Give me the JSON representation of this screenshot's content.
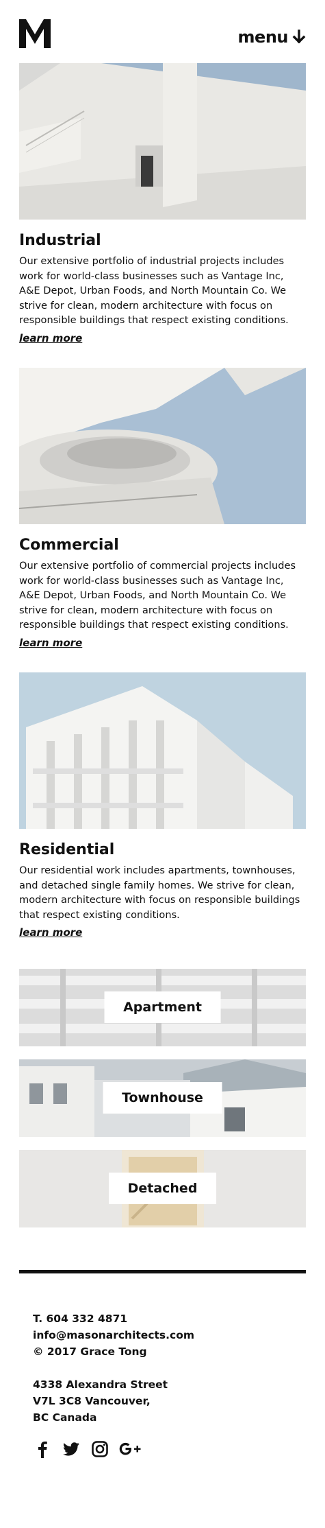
{
  "header": {
    "logo_icon": "mason-logo-icon",
    "menu_label": "menu",
    "menu_icon": "arrow-down-icon"
  },
  "projects": [
    {
      "title": "Industrial",
      "description": "Our extensive portfolio of industrial projects includes work for world-class businesses such as Vantage Inc, A&E Depot, Urban Foods, and North Mountain Co. We strive for clean, modern architecture with focus on responsible buildings that respect existing conditions.",
      "link": "learn more"
    },
    {
      "title": "Commercial",
      "description": "Our extensive portfolio of commercial projects includes work for world-class businesses such as Vantage Inc, A&E Depot, Urban Foods, and North Mountain Co. We strive for clean, modern architecture with focus on responsible buildings that respect existing conditions.",
      "link": "learn more"
    },
    {
      "title": "Residential",
      "description": "Our residential work includes apartments, townhouses, and detached single family homes. We strive for clean, modern architecture with focus on responsible buildings that respect existing conditions.",
      "link": "learn more"
    }
  ],
  "categories": [
    {
      "label": "Apartment"
    },
    {
      "label": "Townhouse"
    },
    {
      "label": "Detached"
    }
  ],
  "footer": {
    "phone": "T. 604 332 4871",
    "email": "info@masonarchitects.com",
    "copyright": "© 2017 Grace Tong",
    "address_line1": "4338 Alexandra Street",
    "address_line2": "V7L 3C8 Vancouver,",
    "address_line3": "BC Canada",
    "social": [
      "facebook-icon",
      "twitter-icon",
      "instagram-icon",
      "google-plus-icon"
    ]
  },
  "colors": {
    "text": "#111111",
    "background": "#ffffff",
    "sky": "#a9bfd4"
  }
}
